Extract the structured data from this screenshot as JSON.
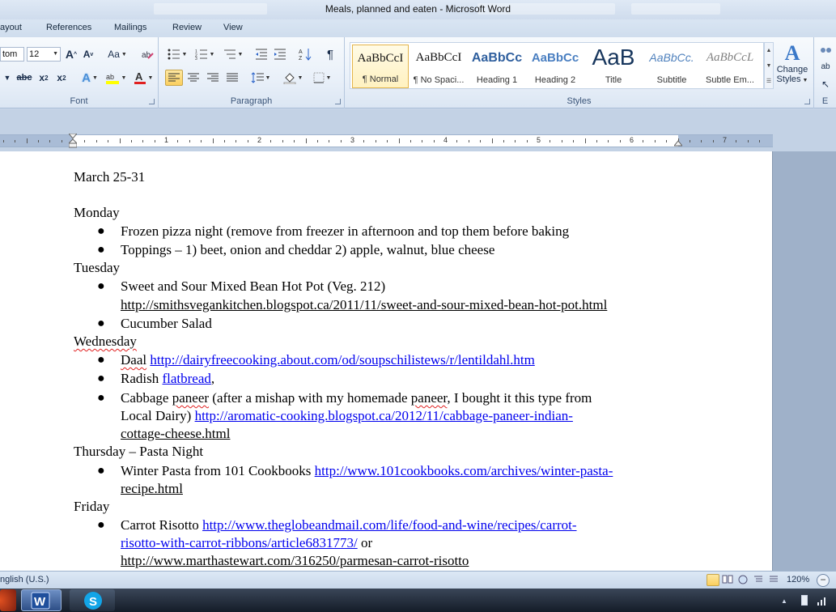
{
  "window": {
    "title": "Meals, planned and eaten  -  Microsoft Word"
  },
  "ribbon_tabs": [
    "ayout",
    "References",
    "Mailings",
    "Review",
    "View"
  ],
  "font_group": {
    "label": "Font",
    "font_name": "tom",
    "font_size": "12"
  },
  "paragraph_group": {
    "label": "Paragraph"
  },
  "styles_group": {
    "label": "Styles",
    "styles": [
      {
        "sample": "AaBbCcI",
        "name": "¶ Normal"
      },
      {
        "sample": "AaBbCcI",
        "name": "¶ No Spaci..."
      },
      {
        "sample": "AaBbCc",
        "name": "Heading 1"
      },
      {
        "sample": "AaBbCc",
        "name": "Heading 2"
      },
      {
        "sample": "AaB",
        "name": "Title"
      },
      {
        "sample": "AaBbCc.",
        "name": "Subtitle"
      },
      {
        "sample": "AaBbCcL",
        "name": "Subtle Em..."
      }
    ],
    "change_styles": [
      "Change",
      "Styles"
    ]
  },
  "editing_group": {
    "label": "E"
  },
  "ruler": {
    "numbers": [
      "1",
      "2",
      "3",
      "4",
      "5",
      "6",
      "7"
    ]
  },
  "document": {
    "heading": "March 25-31",
    "monday": {
      "day": "Monday",
      "items": [
        "Frozen pizza night (remove from freezer in afternoon and top them before baking",
        "Toppings – 1) beet, onion and cheddar  2) apple, walnut, blue cheese"
      ]
    },
    "tuesday": {
      "day": "Tuesday",
      "item1_text": "Sweet and Sour Mixed Bean Hot Pot (Veg. 212)",
      "item1_link": "http://smithsvegankitchen.blogspot.ca/2011/11/sweet-and-sour-mixed-bean-hot-pot.html",
      "item2": "Cucumber Salad"
    },
    "wednesday": {
      "day": "Wednesday",
      "daal_text": "Daal",
      "daal_link": "http://dairyfreecooking.about.com/od/soupschilistews/r/lentildahl.htm",
      "radish_text": "Radish",
      "radish_link": "flatbread",
      "radish_tail": ",",
      "cabbage_line1_a": "Cabbage",
      "cabbage_line1_b": "paneer",
      "cabbage_line1_c": "(after a mishap with my homemade",
      "cabbage_line1_d": "paneer",
      "cabbage_line1_e": ", I bought it this type from",
      "cabbage_line2_text": "Local Dairy)",
      "cabbage_line2_link": "http://aromatic-cooking.blogspot.ca/2012/11/cabbage-paneer-indian-",
      "cabbage_line3_link": "cottage-cheese.html"
    },
    "thursday": {
      "day": "Thursday – Pasta Night",
      "item_text": "Winter Pasta from 101 Cookbooks",
      "item_link1": "http://www.101cookbooks.com/archives/winter-pasta-",
      "item_link2": "recipe.html"
    },
    "friday": {
      "day": "Friday",
      "item_text": "Carrot Risotto",
      "item_link1": "http://www.theglobeandmail.com/life/food-and-wine/recipes/carrot-",
      "item_link2": "risotto-with-carrot-ribbons/article6831773/",
      "item_or": " or",
      "item_link3": "http://www.marthastewart.com/316250/parmesan-carrot-risotto"
    }
  },
  "status_bar": {
    "language": "nglish (U.S.)",
    "zoom": "120%"
  },
  "colors": {
    "link": "#0000ee",
    "ribbon_highlight": "#fbcf5e",
    "spell_squiggle": "#e02020"
  }
}
